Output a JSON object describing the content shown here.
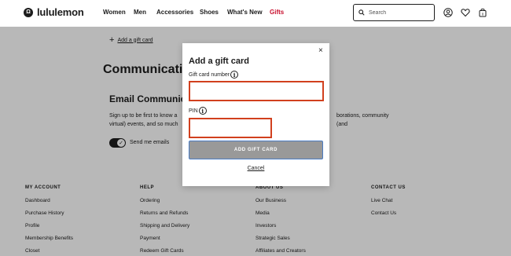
{
  "header": {
    "brand": "lululemon",
    "nav": [
      "Women",
      "Men",
      "Accessories",
      "Shoes",
      "What's New",
      "Gifts"
    ],
    "search_placeholder": "Search"
  },
  "content": {
    "add_gift_card_link": "Add a gift card",
    "communications_title": "Communicatio",
    "email_title": "Email Communica",
    "email_desc_line1": "Sign up to be first to know a",
    "email_desc_line1_right": "borations, community (and",
    "email_desc_line2": "virtual) events, and so much",
    "toggle_label": "Send me emails"
  },
  "footer": {
    "columns": [
      {
        "heading": "MY ACCOUNT",
        "items": [
          "Dashboard",
          "Purchase History",
          "Profile",
          "Membership Benefits",
          "Closet"
        ]
      },
      {
        "heading": "HELP",
        "items": [
          "Ordering",
          "Returns and Refunds",
          "Shipping and Delivery",
          "Payment",
          "Redeem Gift Cards"
        ]
      },
      {
        "heading": "ABOUT US",
        "items": [
          "Our Business",
          "Media",
          "Investors",
          "Strategic Sales",
          "Affiliates and Creators"
        ]
      },
      {
        "heading": "CONTACT US",
        "items": [
          "Live Chat",
          "Contact Us"
        ]
      }
    ]
  },
  "modal": {
    "title": "Add a gift card",
    "close": "×",
    "card_number_label": "Gift card number",
    "pin_label": "PIN",
    "submit_label": "ADD GIFT CARD",
    "cancel_label": "Cancel",
    "accent_color": "#d1401e"
  }
}
